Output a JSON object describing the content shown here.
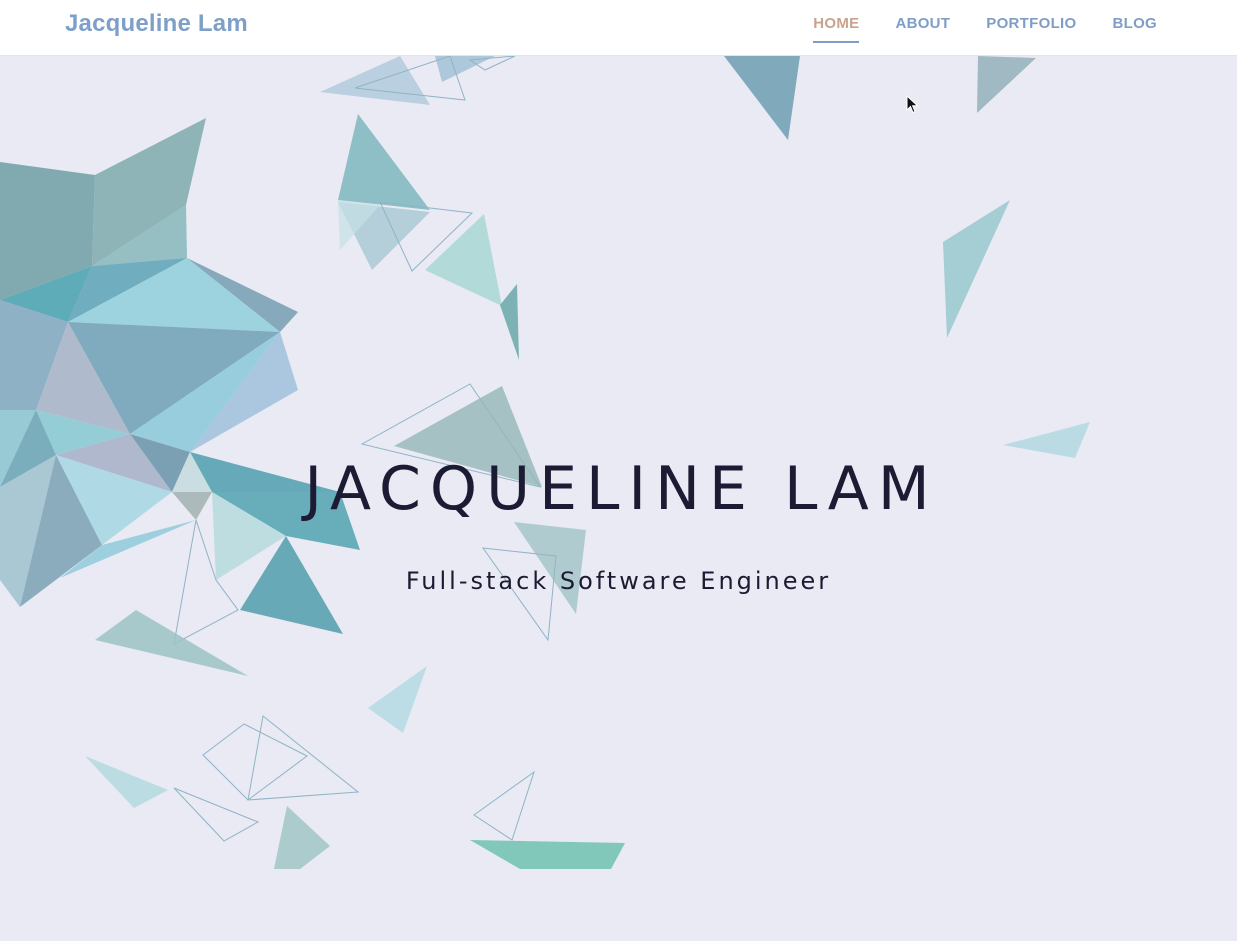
{
  "header": {
    "brand": "Jacqueline Lam",
    "nav": [
      {
        "label": "HOME",
        "active": true
      },
      {
        "label": "ABOUT",
        "active": false
      },
      {
        "label": "PORTFOLIO",
        "active": false
      },
      {
        "label": "BLOG",
        "active": false
      }
    ]
  },
  "hero": {
    "title": "JACQUELINE LAM",
    "subtitle": "Full-stack Software Engineer"
  },
  "colors": {
    "background": "#e9eaf3",
    "brand": "#7ea0c8",
    "nav_active": "#c8a48e",
    "title_text": "#1d1a33"
  },
  "icons": {
    "cursor": "mouse-pointer-icon"
  }
}
